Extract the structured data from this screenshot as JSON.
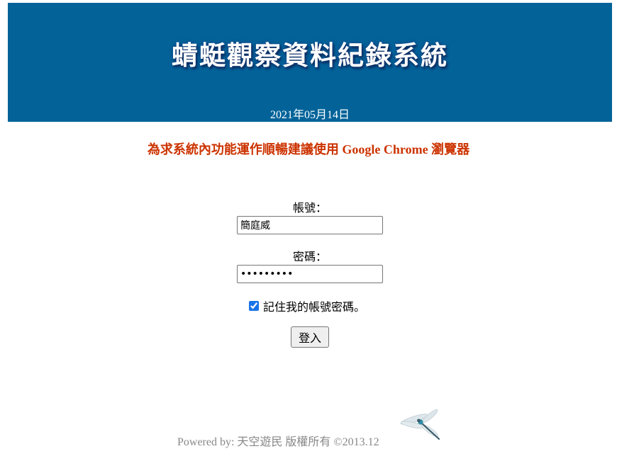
{
  "header": {
    "title": "蜻蜓觀察資料紀錄系統",
    "date": "2021年05月14日",
    "background_color": "#036399"
  },
  "notice": {
    "text": "為求系統內功能運作順暢建議使用 Google Chrome 瀏覽器",
    "color": "#cc3300"
  },
  "login_form": {
    "account_label": "帳號：",
    "account_value": "簡庭威",
    "password_label": "密碼：",
    "password_value": "•••••••••",
    "remember_label": "記住我的帳號密碼。",
    "remember_checked": true,
    "submit_label": "登入"
  },
  "footer": {
    "text": "Powered by: 天空遊民 版權所有 ©2013.12",
    "logo_icon": "dragonfly-icon"
  }
}
